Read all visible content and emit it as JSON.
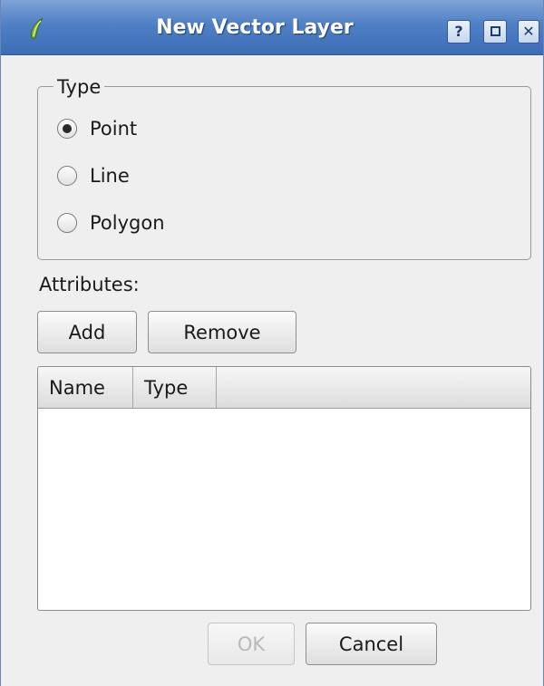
{
  "window": {
    "title": "New Vector Layer",
    "controls": {
      "help": "?",
      "close": "✕"
    }
  },
  "type_group": {
    "title": "Type",
    "options": [
      {
        "label": "Point",
        "checked": true
      },
      {
        "label": "Line",
        "checked": false
      },
      {
        "label": "Polygon",
        "checked": false
      }
    ]
  },
  "attributes": {
    "label": "Attributes:",
    "add_label": "Add",
    "remove_label": "Remove",
    "columns": [
      "Name",
      "Type"
    ],
    "rows": []
  },
  "footer": {
    "ok_label": "OK",
    "cancel_label": "Cancel"
  },
  "colors": {
    "titlebar": "#4f7fc4",
    "dialog_bg": "#efefef"
  }
}
